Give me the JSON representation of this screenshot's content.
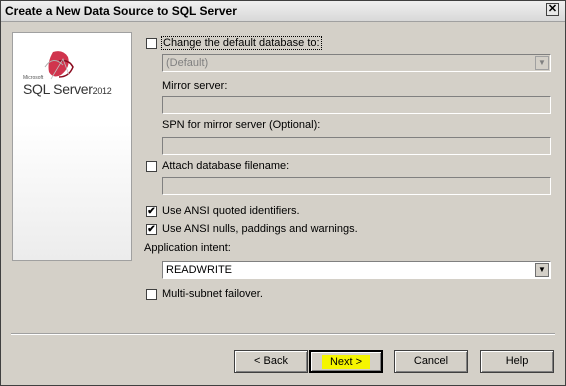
{
  "window": {
    "title": "Create a New Data Source to SQL Server",
    "close_glyph": "✕"
  },
  "logo": {
    "small": "Microsoft",
    "main": "SQL Server",
    "year": "2012"
  },
  "options": {
    "change_default_db": {
      "label": "Change the default database to:",
      "checked": false
    },
    "default_db_dropdown": {
      "value": "(Default)",
      "enabled": false
    },
    "mirror_server": {
      "label": "Mirror server:",
      "value": ""
    },
    "spn_mirror": {
      "label": "SPN for mirror server (Optional):",
      "value": ""
    },
    "attach_db": {
      "label": "Attach database filename:",
      "checked": false
    },
    "attach_db_input": {
      "value": ""
    },
    "ansi_quoted": {
      "label": "Use ANSI quoted identifiers.",
      "checked": true
    },
    "ansi_nulls": {
      "label": "Use ANSI nulls, paddings and warnings.",
      "checked": true
    },
    "app_intent": {
      "label": "Application intent:",
      "value": "READWRITE"
    },
    "multi_subnet": {
      "label": "Multi-subnet failover.",
      "checked": false
    }
  },
  "buttons": {
    "back": "< Back",
    "next": "Next >",
    "cancel": "Cancel",
    "help": "Help"
  },
  "icons": {
    "checkmark": "✔",
    "dropdown_arrow": "▼",
    "close": "close-icon",
    "logo": "sql-server-logo-icon"
  },
  "colors": {
    "next_highlight": "#f5f500",
    "logo_red": "#c8102e"
  }
}
